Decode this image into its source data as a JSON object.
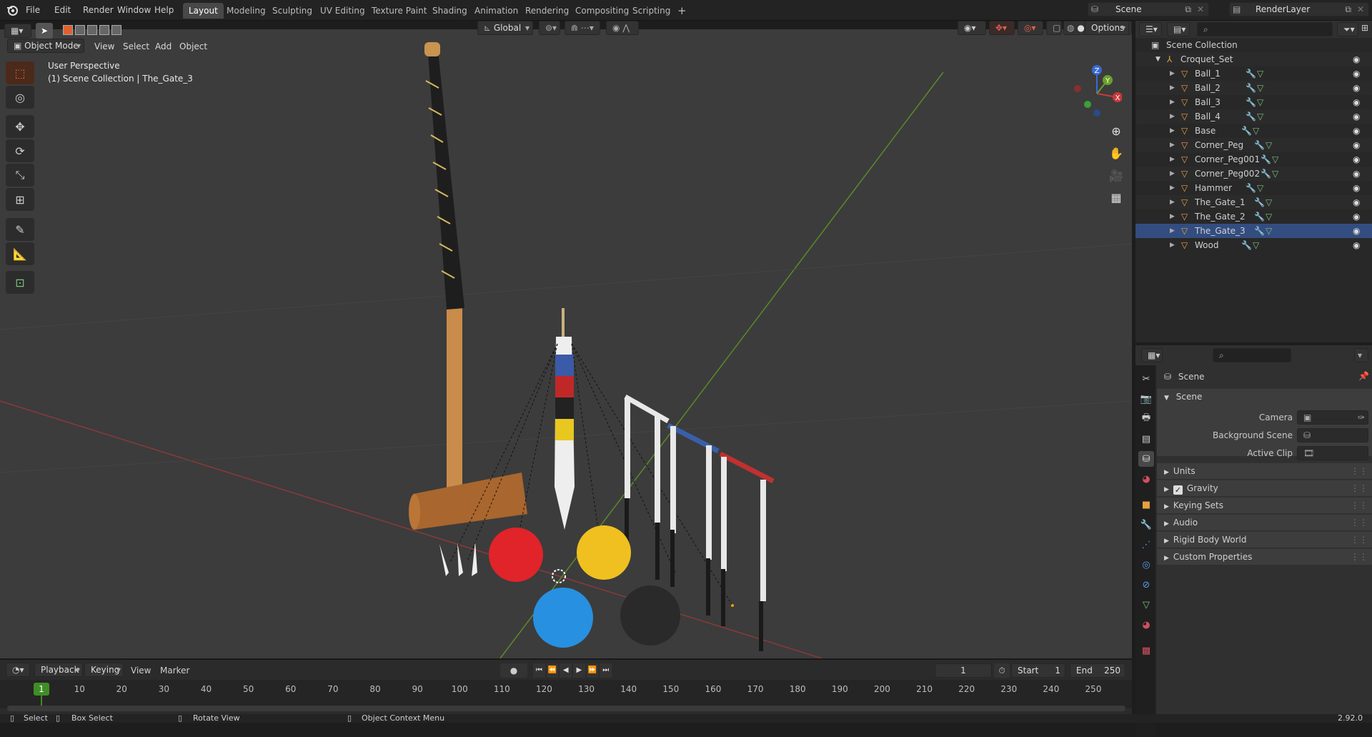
{
  "menus": [
    "File",
    "Edit",
    "Render",
    "Window",
    "Help"
  ],
  "workspaces": [
    "Layout",
    "Modeling",
    "Sculpting",
    "UV Editing",
    "Texture Paint",
    "Shading",
    "Animation",
    "Rendering",
    "Compositing",
    "Scripting"
  ],
  "active_workspace": "Layout",
  "scene_field": "Scene",
  "renderlayer_field": "RenderLayer",
  "viewport": {
    "mode": "Object Mode",
    "menus": [
      "View",
      "Select",
      "Add",
      "Object"
    ],
    "transform_orientation": "Global",
    "options_label": "Options",
    "perspective_label": "User Perspective",
    "context_label": "(1) Scene Collection | The_Gate_3",
    "gizmo_axes": {
      "x": "X",
      "y": "Y",
      "z": "Z"
    }
  },
  "outliner": {
    "root": "Scene Collection",
    "collection": "Croquet_Set",
    "items": [
      "Ball_1",
      "Ball_2",
      "Ball_3",
      "Ball_4",
      "Base",
      "Corner_Peg",
      "Corner_Peg001",
      "Corner_Peg002",
      "Hammer",
      "The_Gate_1",
      "The_Gate_2",
      "The_Gate_3",
      "Wood"
    ],
    "active_item": "The_Gate_3"
  },
  "properties": {
    "header": "Scene",
    "section_scene": "Scene",
    "camera_label": "Camera",
    "background_scene_label": "Background Scene",
    "active_clip_label": "Active Clip",
    "sections": [
      "Units",
      "Gravity",
      "Keying Sets",
      "Audio",
      "Rigid Body World",
      "Custom Properties"
    ],
    "gravity_checked": true
  },
  "timeline": {
    "menus": [
      "Playback",
      "Keying",
      "View",
      "Marker"
    ],
    "current_frame": "1",
    "start_label": "Start",
    "start_value": "1",
    "end_label": "End",
    "end_value": "250",
    "ticks": [
      "1",
      "10",
      "20",
      "30",
      "40",
      "50",
      "60",
      "70",
      "80",
      "90",
      "100",
      "110",
      "120",
      "130",
      "140",
      "150",
      "160",
      "170",
      "180",
      "190",
      "200",
      "210",
      "220",
      "230",
      "240",
      "250"
    ]
  },
  "status": {
    "select": "Select",
    "box_select": "Box Select",
    "rotate_view": "Rotate View",
    "context_menu": "Object Context Menu",
    "version": "2.92.0"
  },
  "colors": {
    "accent": "#e87d0d",
    "active_frame": "#3f8d26",
    "selected_tab": "#484848"
  }
}
